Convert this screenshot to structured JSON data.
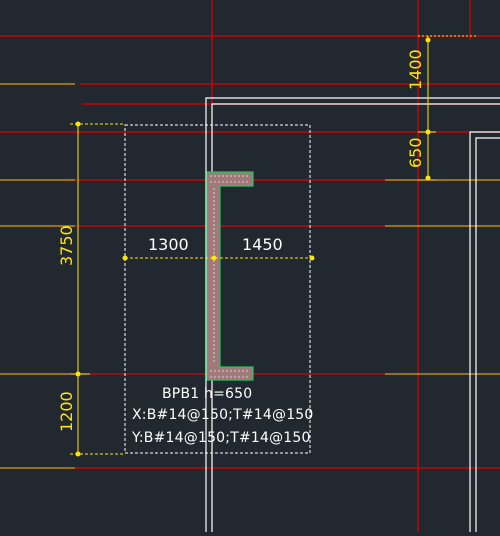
{
  "drawing": {
    "colors": {
      "background": "#212830",
      "axis_line": "#e00000",
      "wall_outline": "#ffffff",
      "beam_outline": "#22c55e",
      "beam_fill": "#c8a0a0",
      "dimension": "#ffe600",
      "label": "#ffffff"
    },
    "dimensions": {
      "right_upper": "1400",
      "right_lower": "650",
      "left_total": "3750",
      "left_bottom": "1200",
      "horiz_left": "1300",
      "horiz_right": "1450"
    },
    "beam_label": {
      "line1": "BPB1 h=650",
      "line2": "X:B#14@150;T#14@150",
      "line3": "Y:B#14@150;T#14@150"
    }
  }
}
